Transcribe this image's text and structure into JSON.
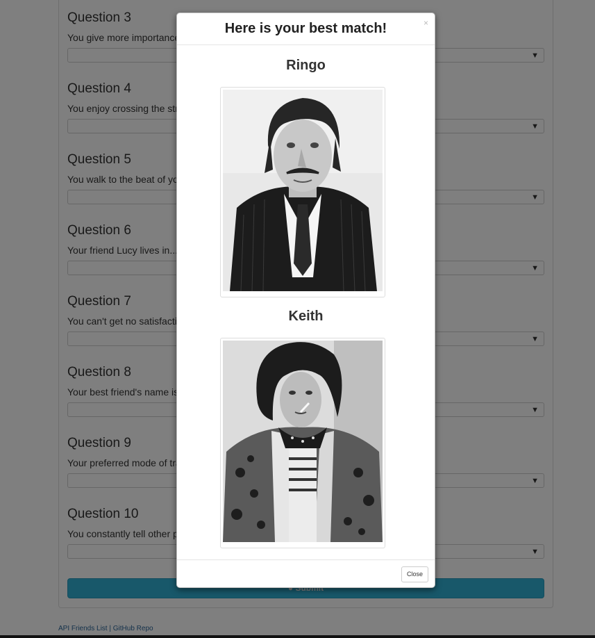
{
  "questions": [
    {
      "title": "Question 3",
      "text": "You give more importance to..."
    },
    {
      "title": "Question 4",
      "text": "You enjoy crossing the street..."
    },
    {
      "title": "Question 5",
      "text": "You walk to the beat of your..."
    },
    {
      "title": "Question 6",
      "text": "Your friend Lucy lives in..."
    },
    {
      "title": "Question 7",
      "text": "You can't get no satisfaction..."
    },
    {
      "title": "Question 8",
      "text": "Your best friend's name is..."
    },
    {
      "title": "Question 9",
      "text": "Your preferred mode of transport..."
    },
    {
      "title": "Question 10",
      "text": "You constantly tell other people..."
    }
  ],
  "submit_label": "Submit",
  "footer": {
    "api_link": "API Friends List",
    "separator": "|",
    "github_link": "GitHub Repo"
  },
  "modal": {
    "title": "Here is your best match!",
    "close_x": "×",
    "matches": [
      {
        "name": "Ringo"
      },
      {
        "name": "Keith"
      }
    ],
    "close_label": "Close"
  },
  "colors": {
    "submit": "#31b0d5",
    "link": "#2a6496",
    "backdrop": "rgba(0,0,0,0.5)"
  }
}
